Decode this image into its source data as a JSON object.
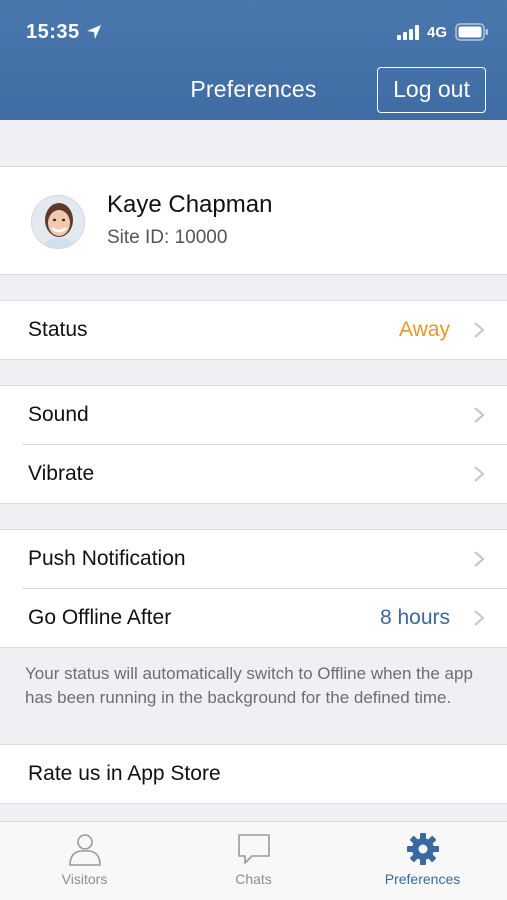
{
  "status_bar": {
    "time": "15:35",
    "network": "4G",
    "icons": [
      "location-arrow-icon",
      "signal-icon",
      "battery-icon"
    ]
  },
  "nav": {
    "title": "Preferences",
    "logout_label": "Log out"
  },
  "profile": {
    "name": "Kaye Chapman",
    "site_id_label": "Site ID:  10000"
  },
  "status_row": {
    "label": "Status",
    "value": "Away",
    "value_color": "#e39a2a"
  },
  "sound_group": {
    "sound_label": "Sound",
    "vibrate_label": "Vibrate"
  },
  "notify_group": {
    "push_label": "Push Notification",
    "offline_label": "Go Offline After",
    "offline_value": "8 hours",
    "offline_value_color": "#3a68a0"
  },
  "footnote": "Your status will automatically switch to Offline when the app has been running in the background for the defined time.",
  "rate_row": {
    "label": "Rate us in App Store"
  },
  "tabbar": {
    "tabs": [
      {
        "label": "Visitors",
        "icon": "person-icon",
        "active": false
      },
      {
        "label": "Chats",
        "icon": "chat-bubble-icon",
        "active": false
      },
      {
        "label": "Preferences",
        "icon": "gear-icon",
        "active": true
      }
    ]
  },
  "colors": {
    "header": "#4574aa",
    "accent": "#3a68a0",
    "away": "#e39a2a"
  }
}
